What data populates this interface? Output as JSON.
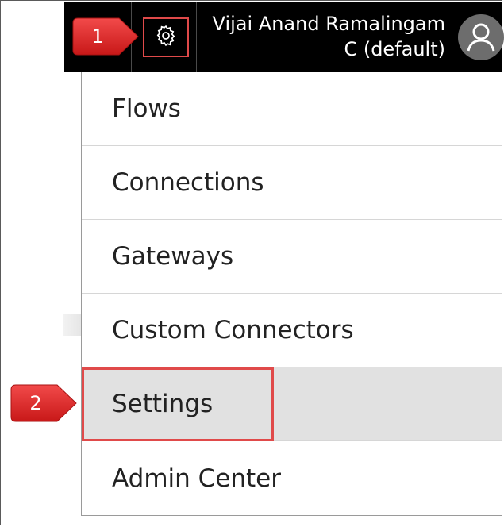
{
  "header": {
    "user_name_line1": "Vijai Anand Ramalingam",
    "user_name_line2": "C (default)"
  },
  "menu": {
    "items": [
      {
        "label": "Flows"
      },
      {
        "label": "Connections"
      },
      {
        "label": "Gateways"
      },
      {
        "label": "Custom Connectors"
      },
      {
        "label": "Settings"
      },
      {
        "label": "Admin Center"
      }
    ]
  },
  "callouts": {
    "step1": "1",
    "step2": "2"
  },
  "colors": {
    "header_bg": "#000000",
    "highlight": "#e04a4a",
    "callout_fill": "#e32b2b",
    "selected_bg": "#e1e1e1"
  },
  "icons": {
    "settings": "gear-icon",
    "user": "user-avatar-icon"
  }
}
